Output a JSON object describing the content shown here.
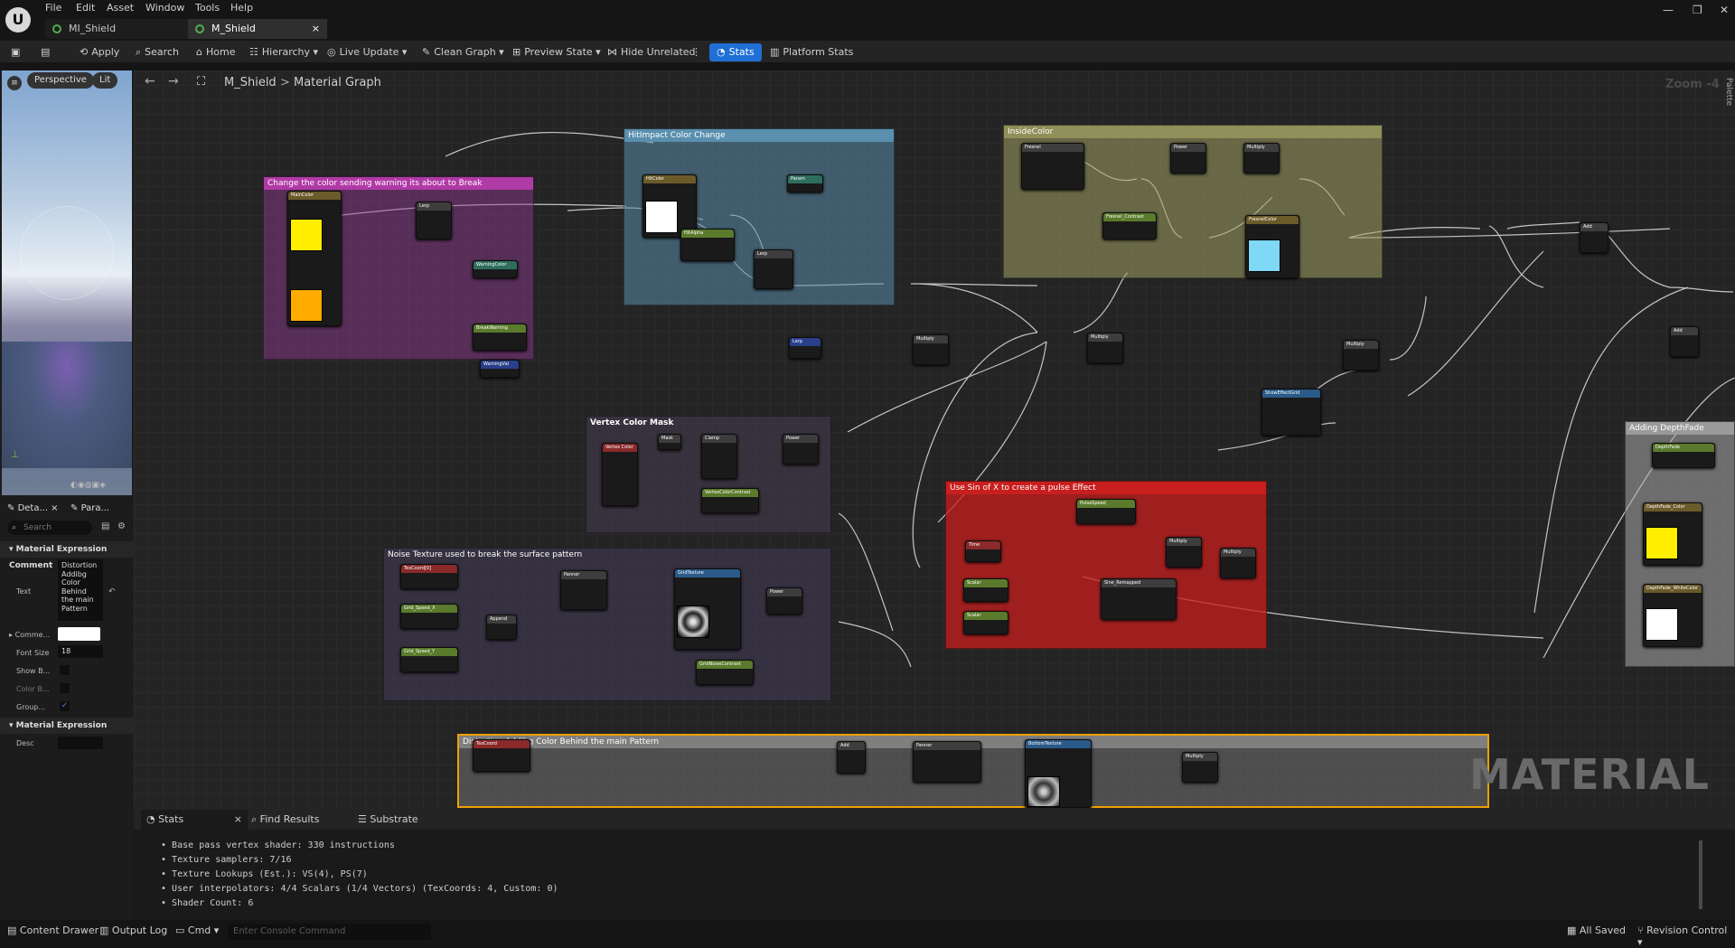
{
  "menu": [
    "File",
    "Edit",
    "Asset",
    "Window",
    "Tools",
    "Help"
  ],
  "tabs": [
    {
      "label": "MI_Shield"
    },
    {
      "label": "M_Shield"
    }
  ],
  "toolbar": {
    "apply": "Apply",
    "search": "Search",
    "home": "Home",
    "hierarchy": "Hierarchy",
    "live_update": "Live Update",
    "clean_graph": "Clean Graph",
    "preview_state": "Preview State",
    "hide_unrelated": "Hide Unrelated",
    "stats": "Stats",
    "platform_stats": "Platform Stats"
  },
  "viewport": {
    "perspective": "Perspective",
    "lit": "Lit"
  },
  "left_tabs": {
    "details": "Deta...",
    "params": "Para..."
  },
  "details": {
    "search_placeholder": "Search",
    "section_comment": "Material Expression Comment",
    "text_label": "Text",
    "text_value": "Distortion Addibg Color Behind the main Pattern",
    "comment_color_label": "Comme...",
    "font_size_label": "Font Size",
    "font_size_value": "18",
    "show_bubble_label": "Show B...",
    "color_bubble_label": "Color B...",
    "group_mode_label": "Group...",
    "section_expression": "Material Expression",
    "desc_label": "Desc"
  },
  "breadcrumb": {
    "asset": "M_Shield",
    "graph": "Material Graph",
    "zoom": "Zoom -4",
    "palette": "Palette"
  },
  "comments": {
    "warning": "Change the color sending warning its about to Break",
    "hitimpact": "HitImpact Color Change",
    "inside": "InsideColor",
    "vertex": "Vertex Color Mask",
    "noise": "Noise Texture used to break the surface pattern",
    "pulse": "Use Sin of X to create a pulse Effect",
    "distortion": "Distortion Addibg Color Behind the main Pattern",
    "depth": "Adding DepthFade"
  },
  "watermark": "MATERIAL",
  "bottom_tabs": {
    "stats": "Stats",
    "find": "Find Results",
    "substrate": "Substrate"
  },
  "stats_lines": [
    "Base pass vertex shader: 330 instructions",
    "Texture samplers: 7/16",
    "Texture Lookups (Est.): VS(4), PS(7)",
    "User interpolators: 4/4 Scalars (1/4 Vectors) (TexCoords: 4, Custom: 0)",
    "Shader Count: 6"
  ],
  "statusbar": {
    "content_drawer": "Content Drawer",
    "output_log": "Output Log",
    "cmd": "Cmd",
    "console_placeholder": "Enter Console Command",
    "all_saved": "All Saved",
    "revision": "Revision Control"
  },
  "colors": {
    "accent": "#1f6fd6",
    "yellow": "#ffee00",
    "orange": "#ffab00",
    "white": "#ffffff",
    "cyan": "#7fd8f5"
  }
}
